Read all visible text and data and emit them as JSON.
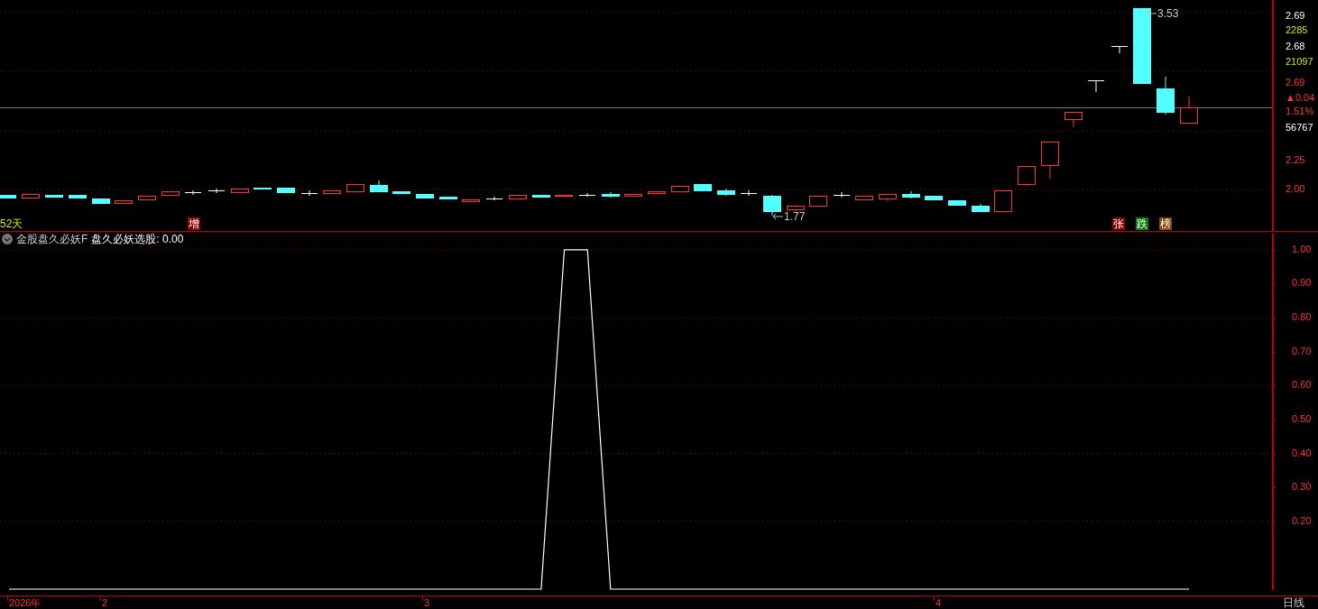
{
  "price_panel": {
    "period_label": "52天",
    "high_marker": "3.53",
    "low_marker": "1.77",
    "badges": [
      {
        "text": "增",
        "color": "#8b0000"
      },
      {
        "text": "张",
        "color": "#8b0000"
      },
      {
        "text": "跌",
        "color": "#0a7a0a"
      },
      {
        "text": "榜",
        "color": "#8b4500"
      }
    ],
    "axis_labels": [
      {
        "text": "2.69",
        "kind": "price"
      },
      {
        "text": "2285",
        "kind": "volume"
      },
      {
        "text": "2.68",
        "kind": "price"
      },
      {
        "text": "21097",
        "kind": "volume"
      },
      {
        "text": "2.69",
        "kind": "change"
      },
      {
        "text": "▲0.04",
        "kind": "change"
      },
      {
        "text": "1.51%",
        "kind": "change"
      },
      {
        "text": "56767",
        "kind": "price"
      },
      {
        "text": "2.25",
        "kind": "change"
      },
      {
        "text": "2.00",
        "kind": "change"
      }
    ]
  },
  "indicator_panel": {
    "name": "金股盘久必妖F",
    "reading": "盘久必妖选股: 0.00",
    "chart_data": {
      "type": "line",
      "series": [
        {
          "color": "#ffffff",
          "values": [
            0,
            0,
            0,
            0,
            0,
            0,
            0,
            0,
            0,
            0,
            0,
            0,
            0,
            0,
            0,
            0,
            0,
            0,
            0,
            0,
            0,
            0,
            0,
            0,
            1,
            1,
            0,
            0,
            0,
            0,
            0,
            0,
            0,
            0,
            0,
            0,
            0,
            0,
            0,
            0,
            0,
            0,
            0,
            0,
            0,
            0,
            0,
            0,
            0,
            0,
            0,
            0
          ]
        }
      ],
      "grid": true,
      "ylim": [
        0,
        1.05
      ],
      "yticks": [
        {
          "value": 0.2,
          "label": "0.20"
        },
        {
          "value": 0.3,
          "label": "0.30"
        },
        {
          "value": 0.4,
          "label": "0.40"
        },
        {
          "value": 0.5,
          "label": "0.50"
        },
        {
          "value": 0.6,
          "label": "0.60"
        },
        {
          "value": 0.7,
          "label": "0.70"
        },
        {
          "value": 0.8,
          "label": "0.80"
        },
        {
          "value": 0.9,
          "label": "0.90"
        },
        {
          "value": 1.0,
          "label": "1.00"
        }
      ]
    }
  },
  "time_axis": {
    "labels": [
      "2026年",
      "2",
      "3",
      "4"
    ],
    "period": "日线"
  }
}
